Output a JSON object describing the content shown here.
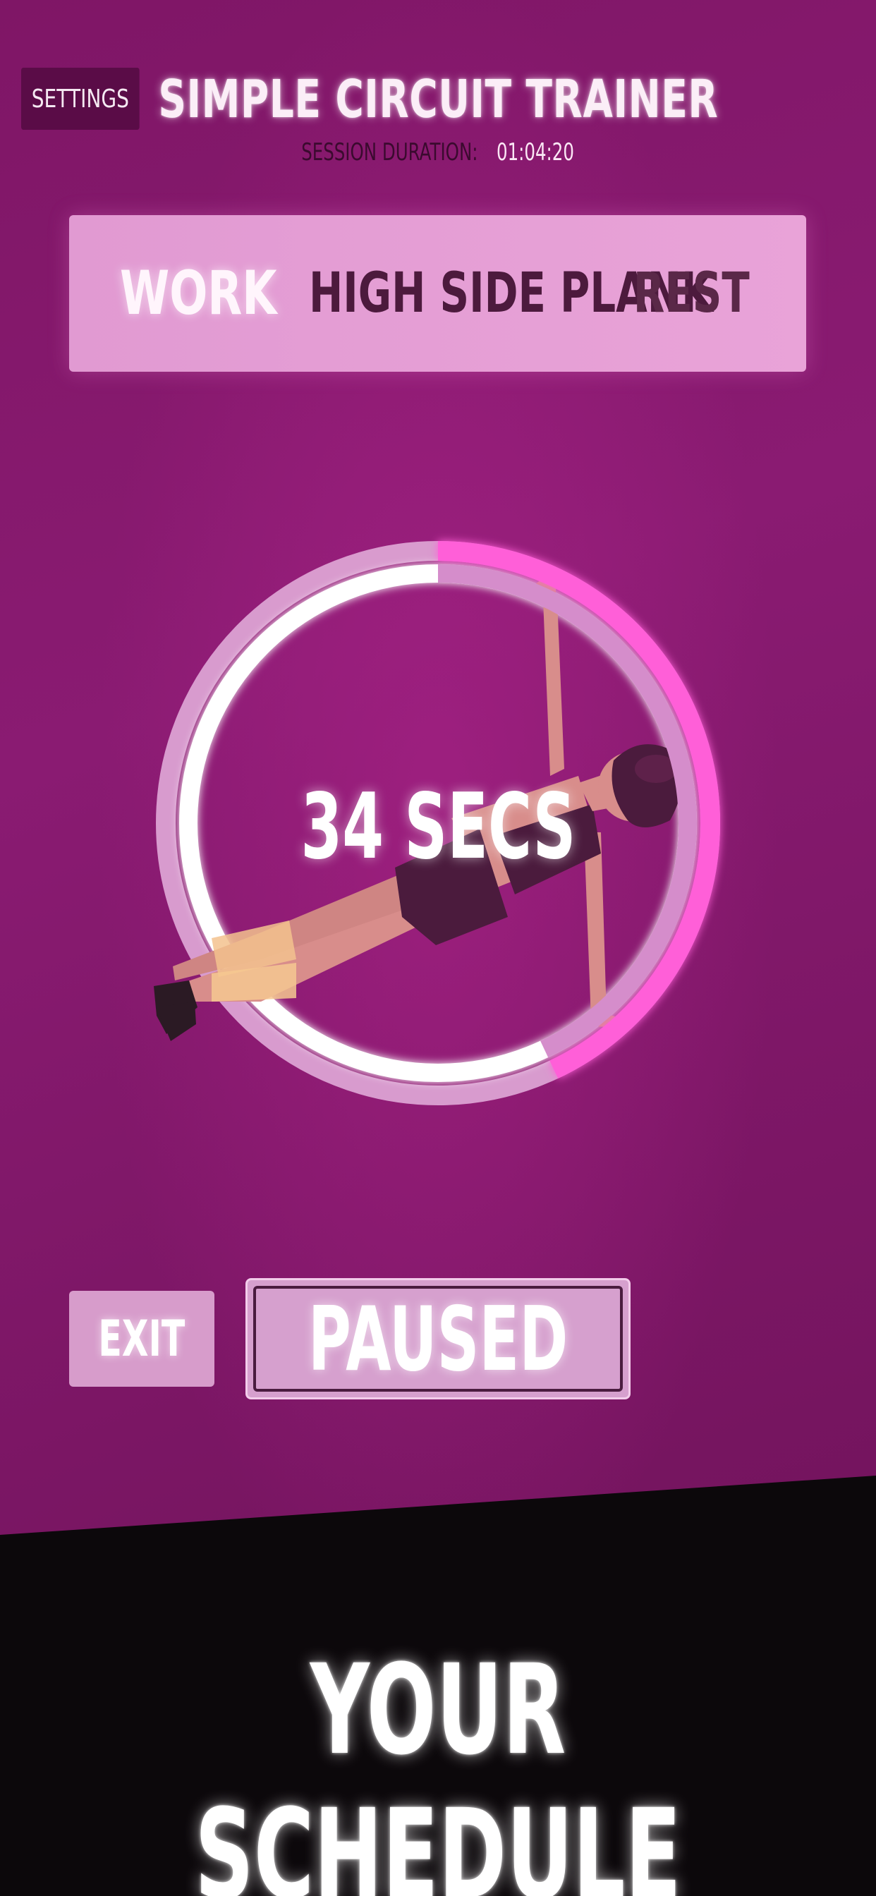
{
  "header": {
    "settings_label": "SETTINGS",
    "title": "SIMPLE CIRCUIT TRAINER",
    "session_label": "SESSION DURATION:",
    "session_value": "01:04:20"
  },
  "status_panel": {
    "phase_active": "WORK",
    "exercise": "HIGH SIDE PLANK",
    "phase_next": "REST"
  },
  "timer": {
    "label": "34 SECS",
    "remaining_fraction": 0.57,
    "elapsed_fraction": 0.43
  },
  "controls": {
    "exit_label": "EXIT",
    "pause_label": "PAUSED"
  },
  "footer": {
    "caption": "YOUR SCHEDULE"
  },
  "colors": {
    "background": "#8a1b72",
    "panel": "#e6a0d6",
    "progress_accent": "#ff5fd8",
    "footer_band": "#0c080b"
  }
}
